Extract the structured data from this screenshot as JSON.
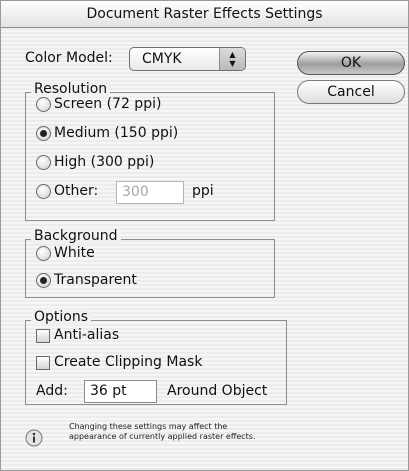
{
  "window": {
    "title": "Document Raster Effects Settings"
  },
  "color_model": {
    "label": "Color Model:",
    "value": "CMYK"
  },
  "buttons": {
    "ok": "OK",
    "cancel": "Cancel"
  },
  "resolution": {
    "title": "Resolution",
    "options": [
      {
        "label": "Screen (72 ppi)",
        "selected": false
      },
      {
        "label": "Medium (150 ppi)",
        "selected": true
      },
      {
        "label": "High (300 ppi)",
        "selected": false
      },
      {
        "label": "Other:",
        "selected": false
      }
    ],
    "other_value": "300",
    "other_unit": "ppi"
  },
  "background": {
    "title": "Background",
    "options": [
      {
        "label": "White",
        "selected": false
      },
      {
        "label": "Transparent",
        "selected": true
      }
    ]
  },
  "options": {
    "title": "Options",
    "anti_alias": {
      "label": "Anti-alias",
      "checked": false
    },
    "clipping_mask": {
      "label": "Create Clipping Mask",
      "checked": false
    },
    "add_label": "Add:",
    "add_value": "36 pt",
    "add_suffix": "Around Object"
  },
  "info": {
    "icon": "info-icon",
    "text": "Changing these settings may affect the appearance of currently applied raster effects."
  }
}
